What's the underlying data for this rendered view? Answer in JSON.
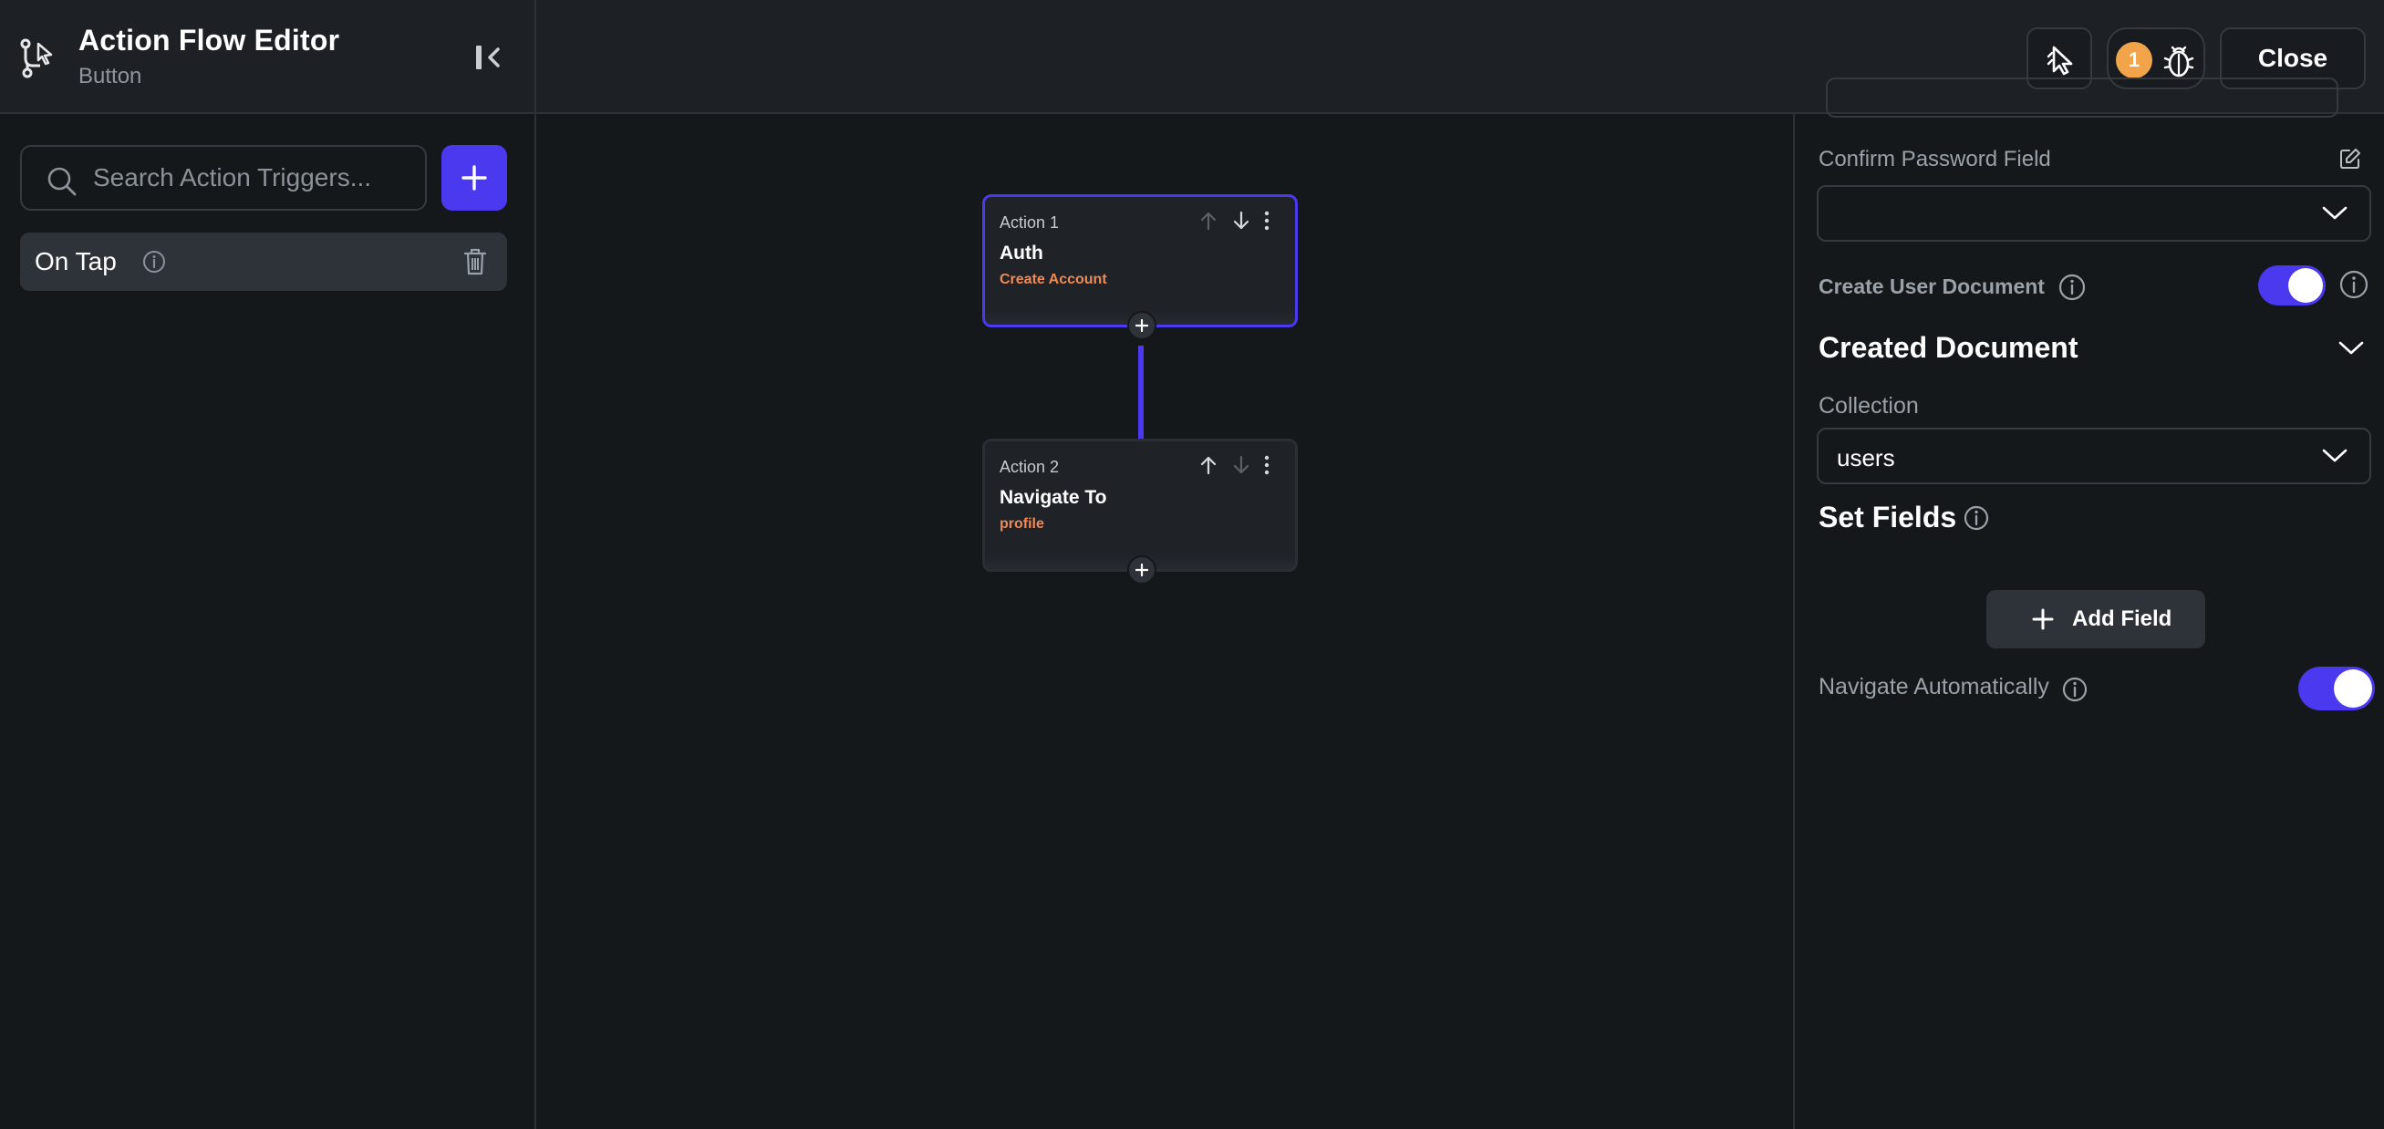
{
  "header": {
    "title": "Action Flow Editor",
    "subtitle": "Button",
    "debug_count": "1",
    "close_label": "Close"
  },
  "left_panel": {
    "search_placeholder": "Search Action Triggers...",
    "triggers": [
      {
        "label": "On Tap"
      }
    ]
  },
  "canvas": {
    "actions": [
      {
        "number": "Action 1",
        "title": "Auth",
        "subtitle": "Create Account",
        "selected": true
      },
      {
        "number": "Action 2",
        "title": "Navigate To",
        "subtitle": "profile",
        "selected": false
      }
    ]
  },
  "right_panel": {
    "confirm_password_label": "Confirm Password Field",
    "confirm_password_value": "",
    "create_user_document_label": "Create User Document",
    "create_user_document_on": true,
    "created_document_title": "Created Document",
    "collection_label": "Collection",
    "collection_value": "users",
    "set_fields_title": "Set Fields",
    "add_field_label": "Add Field",
    "navigate_automatically_label": "Navigate Automatically",
    "navigate_automatically_on": true
  },
  "colors": {
    "accent": "#4b39ef",
    "warning_badge": "#f2a44a",
    "action_subtitle": "#ee8a57",
    "background": "#14181b"
  },
  "icons": {
    "flow": "action-flow-icon",
    "collapse": "collapse-panel-icon",
    "pointer": "select-pointer-icon",
    "debug": "bug-icon",
    "search": "search-icon",
    "add": "plus-icon",
    "info": "info-icon",
    "delete": "trash-icon",
    "edit": "edit-icon",
    "dropdown": "chevron-down-icon"
  }
}
